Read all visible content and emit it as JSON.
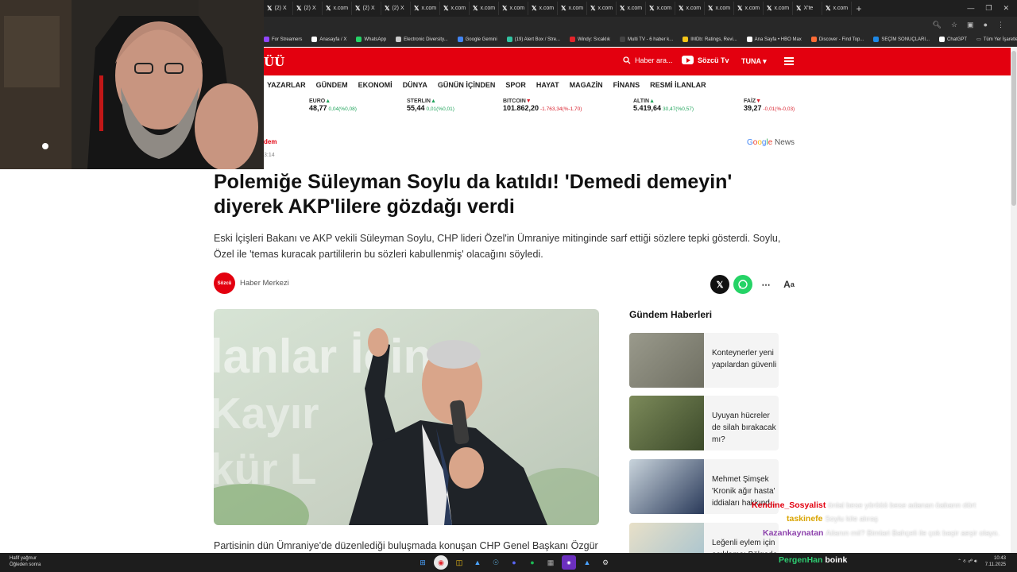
{
  "browser": {
    "tabs": [
      {
        "icon": "x-icon",
        "label": "(2) X"
      },
      {
        "icon": "x-icon",
        "label": "(2) X"
      },
      {
        "icon": "x-icon",
        "label": "x.com"
      },
      {
        "icon": "x-icon",
        "label": "(2) X"
      },
      {
        "icon": "x-icon",
        "label": "(2) X"
      },
      {
        "icon": "x-icon",
        "label": "x.com"
      },
      {
        "icon": "x-icon",
        "label": "x.com"
      },
      {
        "icon": "x-icon",
        "label": "x.com"
      },
      {
        "icon": "x-icon",
        "label": "x.com"
      },
      {
        "icon": "x-icon",
        "label": "x.com"
      },
      {
        "icon": "x-icon",
        "label": "x.com"
      },
      {
        "icon": "x-icon",
        "label": "x.com"
      },
      {
        "icon": "x-icon",
        "label": "x.com"
      },
      {
        "icon": "x-icon",
        "label": "x.com"
      },
      {
        "icon": "x-icon",
        "label": "x.com"
      },
      {
        "icon": "x-icon",
        "label": "x.com"
      },
      {
        "icon": "x-icon",
        "label": "x.com"
      },
      {
        "icon": "x-icon",
        "label": "x.com"
      },
      {
        "icon": "x-icon",
        "label": "X'te"
      },
      {
        "icon": "x-icon",
        "label": "x.com"
      }
    ],
    "bookmarks": [
      {
        "label": "For Streamers",
        "color": "#9146ff"
      },
      {
        "label": "Anasayfa / X",
        "color": "#ffffff"
      },
      {
        "label": "WhatsApp",
        "color": "#25d366"
      },
      {
        "label": "Electronic Diversity...",
        "color": "#cccccc"
      },
      {
        "label": "Google Gemini",
        "color": "#4285f4"
      },
      {
        "label": "(19) Alert Box / Stre...",
        "color": "#31c3a2"
      },
      {
        "label": "Windy: Sıcaklık",
        "color": "#e3242b"
      },
      {
        "label": "Multi TV - 6 haber k...",
        "color": "#444444"
      },
      {
        "label": "IMDb: Ratings, Revi...",
        "color": "#f5c518"
      },
      {
        "label": "Ana Sayfa • HBO Max",
        "color": "#ffffff"
      },
      {
        "label": "Discover - Find Top...",
        "color": "#ff6b35"
      },
      {
        "label": "SEÇİM SONUÇLARI...",
        "color": "#1e88e5"
      },
      {
        "label": "ChatGPT",
        "color": "#ffffff"
      }
    ],
    "all_bookmarks": "Tüm Yer İşaretleri"
  },
  "site": {
    "logo": "SÖZCÜ",
    "search_placeholder": "Haber ara...",
    "tv_label": "Sözcü Tv",
    "user_label": "TUNA",
    "nav": [
      "YAZARLAR",
      "GÜNDEM",
      "EKONOMİ",
      "DÜNYA",
      "GÜNÜN İÇİNDEN",
      "SPOR",
      "HAYAT",
      "MAGAZİN",
      "FİNANS",
      "RESMİ İLANLAR"
    ],
    "ticker": [
      {
        "name": "EURO",
        "dir": "up",
        "value": "48,77",
        "change": "0,04(%0,08)"
      },
      {
        "name": "STERLIN",
        "dir": "up",
        "value": "55,44",
        "change": "0,01(%0,01)"
      },
      {
        "name": "BITCOIN",
        "dir": "down",
        "value": "101.862,20",
        "change": "-1.763,34(%-1,70)"
      },
      {
        "name": "ALTIN",
        "dir": "up",
        "value": "5.419,64",
        "change": "30,47(%0,57)"
      },
      {
        "name": "FAİZ",
        "dir": "down",
        "value": "39,27",
        "change": "-0,01(%-0,03)"
      }
    ],
    "up_color": "#1fa35a",
    "down_color": "#d91f2c"
  },
  "article": {
    "category": "dem",
    "time": "3:14",
    "google_news": "News",
    "headline": "Polemiğe Süleyman Soylu da katıldı! 'Demedi demeyin' diyerek AKP'lilere gözdağı verdi",
    "lead": "Eski İçişleri Bakanı ve AKP vekili Süleyman Soylu, CHP lideri Özel'in Ümraniye mitinginde sarf ettiği sözlere tepki gösterdi. Soylu, Özel ile 'temas kuracak partililerin bu sözleri kabullenmiş' olacağını söyledi.",
    "author_logo": "Sözcü",
    "author": "Haber Merkezi",
    "body_start": "Partisinin dün Ümraniye'de düzenlediği buluşmada konuşan CHP Genel Başkanı Özgür"
  },
  "sidebar": {
    "title": "Gündem Haberleri",
    "items": [
      {
        "title": "Konteynerler yeni yapılardan güvenli"
      },
      {
        "title": "Uyuyan hücreler de silah bırakacak mı?"
      },
      {
        "title": "Mehmet Şimşek 'Kronik ağır hasta' iddiaları hakkınd..."
      },
      {
        "title": "Leğenli eylem için açıklama: Bölgede"
      }
    ]
  },
  "chat": [
    {
      "user": "Kendine_Sosyalist",
      "color": "#e3000f",
      "message": "önlal bese yörööö bese adanan öabann dört"
    },
    {
      "user": "taskinefe",
      "color": "#d9a400",
      "message": "Soylu kile alıraş"
    },
    {
      "user": "Kazankaynatan",
      "color": "#8e44ad",
      "message": "Ailanın mil? Bimlari Bahçeli ile çok başir aeşir olayo."
    },
    {
      "user": "PergenHan",
      "color": "#2ecc71",
      "message": "boink"
    }
  ],
  "taskbar": {
    "weather_line1": "Hafif yağmur",
    "weather_line2": "Öğleden sonra",
    "time": "10:43",
    "date": "7.11.2025"
  }
}
